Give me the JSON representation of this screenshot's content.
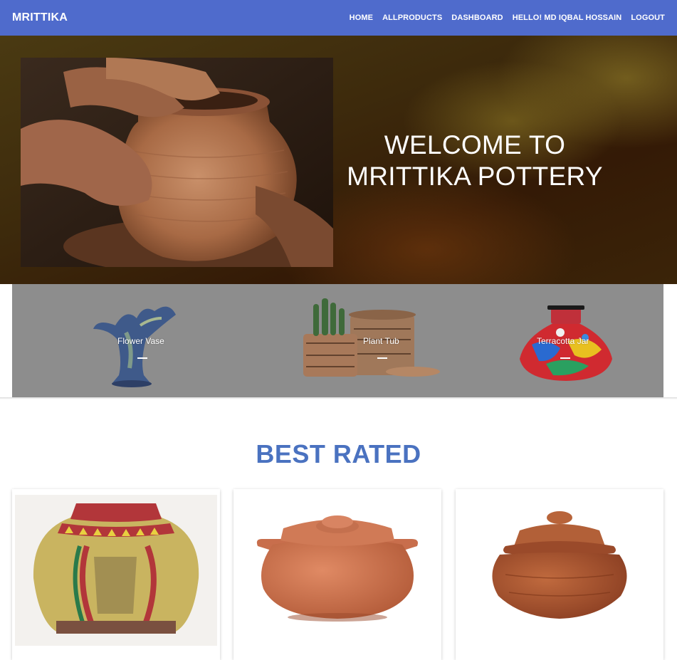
{
  "navbar": {
    "brand": "MRITTIKA",
    "links": [
      "HOME",
      "ALLPRODUCTS",
      "DASHBOARD",
      "HELLO! MD IQBAL HOSSAIN",
      "LOGOUT"
    ]
  },
  "hero": {
    "title_line1": "WELCOME TO",
    "title_line2": "MRITTIKA POTTERY"
  },
  "categories": [
    {
      "label": "Flower Vase"
    },
    {
      "label": "Plant Tub"
    },
    {
      "label": "Terracotta Jar"
    }
  ],
  "best_rated": {
    "title": "BEST RATED"
  }
}
